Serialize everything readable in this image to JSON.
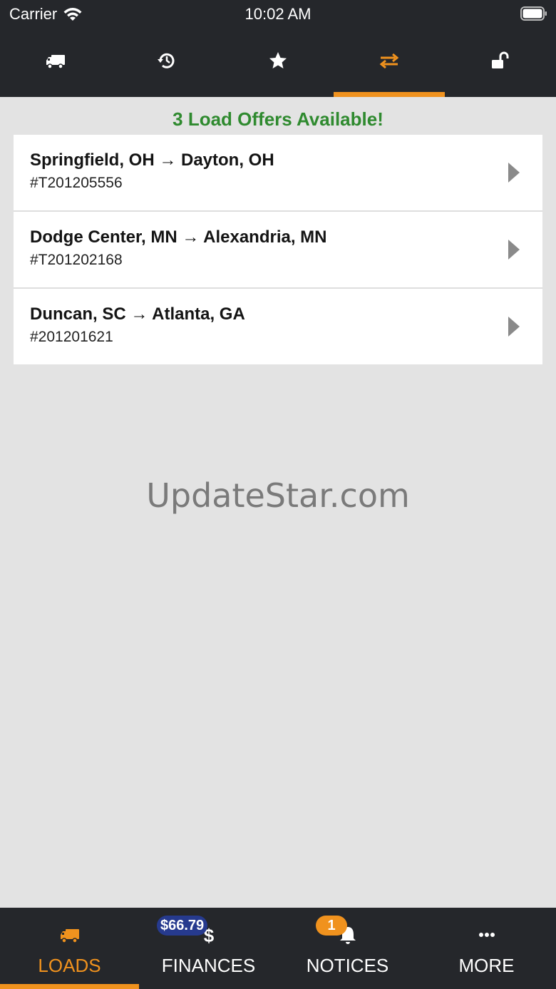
{
  "status_bar": {
    "carrier": "Carrier",
    "time": "10:02 AM"
  },
  "top_nav": {
    "tabs": [
      {
        "icon": "truck-icon",
        "active": false
      },
      {
        "icon": "history-icon",
        "active": false
      },
      {
        "icon": "star-icon",
        "active": false
      },
      {
        "icon": "swap-arrows-icon",
        "active": true
      },
      {
        "icon": "unlock-icon",
        "active": false
      }
    ]
  },
  "main": {
    "offers_title": "3 Load Offers Available!",
    "offers": [
      {
        "route": "Springfield, OH → Dayton, OH",
        "id": "#T201205556"
      },
      {
        "route": "Dodge Center, MN → Alexandria, MN",
        "id": "#T201202168"
      },
      {
        "route": "Duncan, SC → Atlanta, GA",
        "id": "#201201621"
      }
    ],
    "watermark": "UpdateStar.com"
  },
  "bottom_nav": {
    "tabs": [
      {
        "label": "LOADS",
        "icon": "truck-icon",
        "active": true
      },
      {
        "label": "FINANCES",
        "icon": "dollar-icon",
        "badge": "$66.79"
      },
      {
        "label": "NOTICES",
        "icon": "bell-icon",
        "badge": "1"
      },
      {
        "label": "MORE",
        "icon": "more-dots-icon"
      }
    ]
  },
  "colors": {
    "accent": "#f0921e",
    "bar": "#25272b",
    "success": "#2f8a2f",
    "badge_blue": "#263a8e"
  }
}
